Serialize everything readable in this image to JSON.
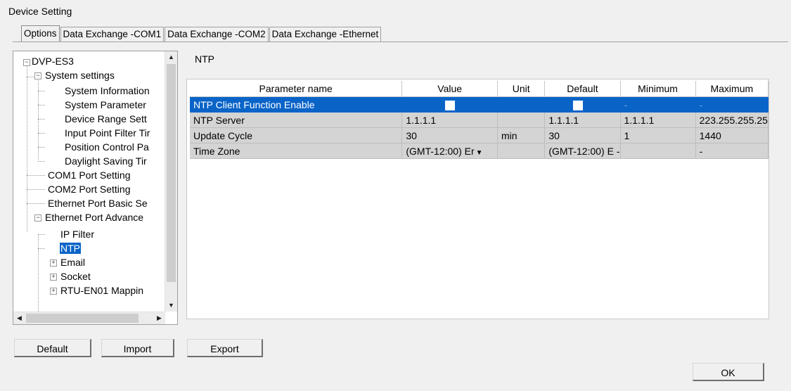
{
  "window": {
    "title": "Device Setting"
  },
  "tabs": [
    {
      "label": "Options",
      "active": true
    },
    {
      "label": "Data Exchange -COM1",
      "active": false
    },
    {
      "label": "Data Exchange -COM2",
      "active": false
    },
    {
      "label": "Data Exchange -Ethernet",
      "active": false
    }
  ],
  "tree": {
    "items": [
      {
        "label": "DVP-ES3",
        "level": 0,
        "expander": "-"
      },
      {
        "label": "System settings",
        "level": 1,
        "expander": "-"
      },
      {
        "label": "System Information",
        "level": 2
      },
      {
        "label": "System Parameter",
        "level": 2
      },
      {
        "label": "Device Range Sett",
        "level": 2
      },
      {
        "label": "Input Point Filter Tir",
        "level": 2
      },
      {
        "label": "Position Control Pa",
        "level": 2
      },
      {
        "label": "Daylight Saving Tir",
        "level": 2
      },
      {
        "label": "COM1 Port Setting",
        "level": 1
      },
      {
        "label": "COM2 Port Setting",
        "level": 1
      },
      {
        "label": "Ethernet Port Basic Se",
        "level": 1
      },
      {
        "label": "Ethernet Port Advance",
        "level": 1,
        "expander": "-"
      },
      {
        "label": "IP Filter",
        "level": 2
      },
      {
        "label": "NTP",
        "level": 2,
        "selected": true
      },
      {
        "label": "Email",
        "level": 2,
        "expander": "+"
      },
      {
        "label": "Socket",
        "level": 2,
        "expander": "+"
      },
      {
        "label": "RTU-EN01 Mappin",
        "level": 2,
        "expander": "+"
      }
    ]
  },
  "panel": {
    "title": "NTP"
  },
  "grid": {
    "columns": [
      "Parameter name",
      "Value",
      "Unit",
      "Default",
      "Minimum",
      "Maximum"
    ],
    "rows": [
      {
        "name": "NTP Client Function Enable",
        "value": "",
        "unit": "",
        "default": "",
        "min": "-",
        "max": "-",
        "checkbox": true
      },
      {
        "name": "NTP Server",
        "value": "1.1.1.1",
        "unit": "",
        "default": "1.1.1.1",
        "min": "1.1.1.1",
        "max": "223.255.255.25"
      },
      {
        "name": "Update Cycle",
        "value": "30",
        "unit": "min",
        "default": "30",
        "min": "1",
        "max": "1440"
      },
      {
        "name": "Time Zone",
        "value": "(GMT-12:00) Er",
        "unit": "",
        "default": "(GMT-12:00) E",
        "min": "-",
        "max": "-",
        "dropdown": true
      }
    ]
  },
  "buttons": {
    "default": "Default",
    "import": "Import",
    "export": "Export",
    "ok": "OK"
  }
}
